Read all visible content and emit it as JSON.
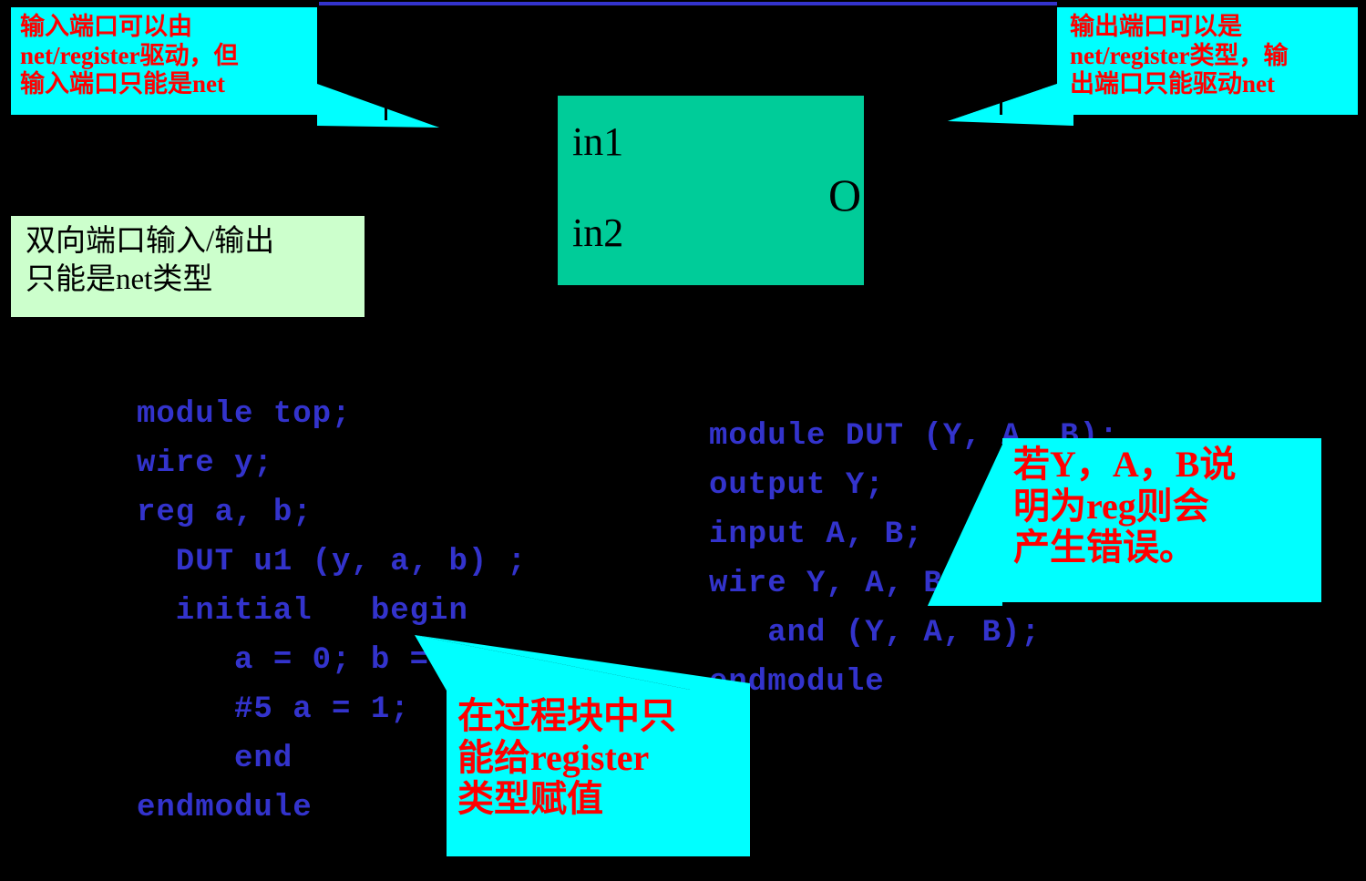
{
  "colors": {
    "background": "#000000",
    "callout_fill": "#00ffff",
    "callout_text": "#ff0000",
    "note_fill": "#ccffcc",
    "note_text": "#000000",
    "module_fill": "#00cc99",
    "code_text": "#3333cc",
    "rule": "#3333cc"
  },
  "callouts": {
    "input_port": "输入端口可以由\nnet/register驱动，但\n输入端口只能是net",
    "output_port": "输出端口可以是\nnet/register类型，输\n出端口只能驱动net",
    "reg_error": "若Y，A，B说\n明为reg则会\n产生错误。",
    "procedural": "在过程块中只\n能给register\n类型赋值"
  },
  "note": {
    "inout_port": "双向端口输入/输出\n只能是net类型"
  },
  "module_diagram": {
    "input1": "in1",
    "input2": "in2",
    "output": "O"
  },
  "code": {
    "top_module": "module top;\nwire y;\nreg a, b;\n  DUT u1 (y, a, b) ;\n  initial   begin\n     a = 0; b = 0;\n     #5 a = 1;\n     end\nendmodule",
    "dut_module": "module DUT (Y, A, B);\noutput Y;\ninput A, B;\nwire Y, A, B;\n   and (Y, A, B);\nendmodule"
  }
}
